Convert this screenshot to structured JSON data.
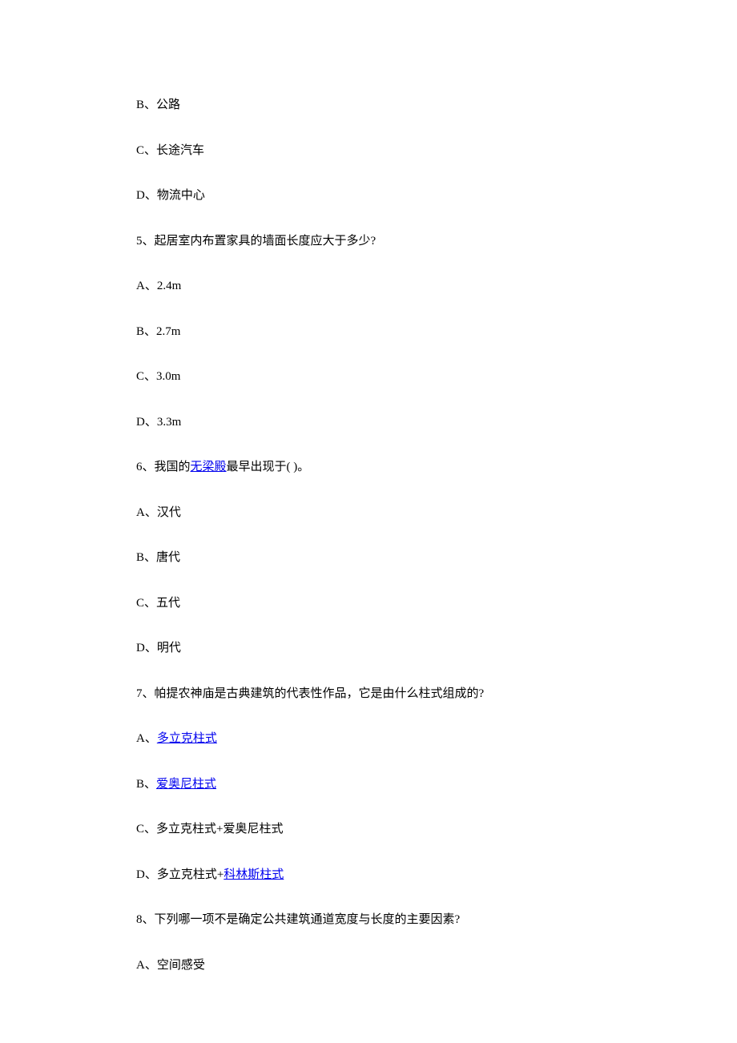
{
  "items": [
    {
      "type": "option",
      "prefix": "B、",
      "text": "公路"
    },
    {
      "type": "option",
      "prefix": "C、",
      "text": "长途汽车"
    },
    {
      "type": "option",
      "prefix": "D、",
      "text": "物流中心"
    },
    {
      "type": "question",
      "text": "5、起居室内布置家具的墙面长度应大于多少?"
    },
    {
      "type": "option",
      "prefix": "A、",
      "text": "2.4m"
    },
    {
      "type": "option",
      "prefix": "B、",
      "text": "2.7m"
    },
    {
      "type": "option",
      "prefix": "C、",
      "text": "3.0m"
    },
    {
      "type": "option",
      "prefix": "D、",
      "text": "3.3m"
    },
    {
      "type": "question_with_link",
      "before": "6、我国的",
      "link": "无梁殿",
      "after": "最早出现于(  )。"
    },
    {
      "type": "option",
      "prefix": "A、",
      "text": "汉代"
    },
    {
      "type": "option",
      "prefix": "B、",
      "text": "唐代"
    },
    {
      "type": "option",
      "prefix": "C、",
      "text": "五代"
    },
    {
      "type": "option",
      "prefix": "D、",
      "text": "明代"
    },
    {
      "type": "question",
      "text": "7、帕提农神庙是古典建筑的代表性作品，它是由什么柱式组成的?"
    },
    {
      "type": "option_with_link",
      "prefix": "A、",
      "link": "多立克柱式",
      "after": ""
    },
    {
      "type": "option_with_link",
      "prefix": "B、",
      "link": "爱奥尼柱式",
      "after": ""
    },
    {
      "type": "option",
      "prefix": "C、",
      "text": "多立克柱式+爱奥尼柱式"
    },
    {
      "type": "option_with_link",
      "prefix": "D、多立克柱式+",
      "link": "科林斯柱式",
      "after": ""
    },
    {
      "type": "question",
      "text": "8、下列哪一项不是确定公共建筑通道宽度与长度的主要因素?"
    },
    {
      "type": "option",
      "prefix": "A、",
      "text": "空间感受"
    }
  ]
}
